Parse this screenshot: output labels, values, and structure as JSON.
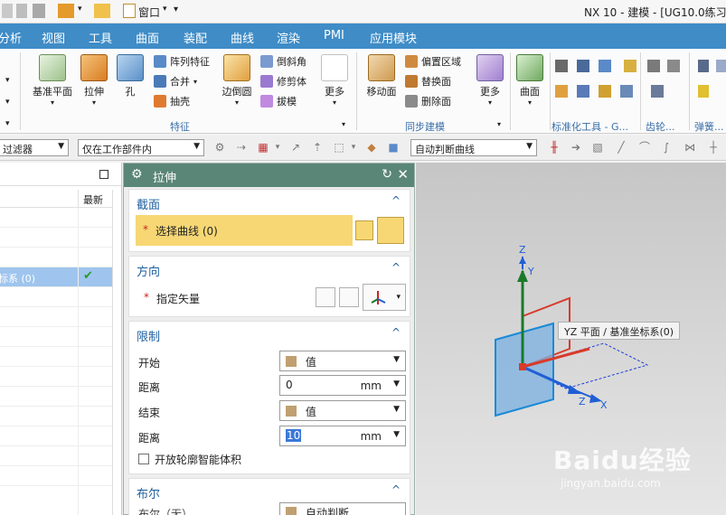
{
  "title_bar": {
    "window_menu": "窗口",
    "app_title": "NX 10 - 建模 - [UG10.0练习]"
  },
  "menu_bar": {
    "items": [
      "分析",
      "视图",
      "工具",
      "曲面",
      "装配",
      "曲线",
      "渲染",
      "PMI",
      "应用模块"
    ]
  },
  "ribbon": {
    "feature_group": {
      "label": "特征",
      "datum_plane": "基准平面",
      "extrude": "拉伸",
      "hole": "孔",
      "pattern_feature": "阵列特征",
      "unite": "合并",
      "shell": "抽壳",
      "edge_blend": "边倒圆",
      "chamfer": "倒斜角",
      "trim_body": "修剪体",
      "draft": "拔模",
      "more": "更多"
    },
    "sync_group": {
      "label": "同步建模",
      "move_face": "移动面",
      "offset_region": "偏置区域",
      "replace_face": "替换面",
      "delete_face": "删除面",
      "more": "更多"
    },
    "surface_label": "曲面",
    "standard_parts_label": "标准化工具 - G...",
    "gear_label": "齿轮...",
    "spring_label": "弹簧..."
  },
  "selection_bar": {
    "type_filter": "过滤器",
    "scope": "仅在工作部件内",
    "curve_rule": "自动判断曲线"
  },
  "navigator": {
    "col_latest": "最新",
    "selected_row": "标系 (0)",
    "check_mark": "✔"
  },
  "extrude_dialog": {
    "title": "拉伸",
    "section": {
      "header": "截面",
      "select_curve": "选择曲线 (0)",
      "required_mark": "*"
    },
    "direction": {
      "header": "方向",
      "specify_vector": "指定矢量",
      "required_mark": "*"
    },
    "limits": {
      "header": "限制",
      "start_label": "开始",
      "start_value": "值",
      "distance1_label": "距离",
      "distance1_value": "0",
      "distance1_unit": "mm",
      "end_label": "结束",
      "end_value": "值",
      "distance2_label": "距离",
      "distance2_value": "10",
      "distance2_unit": "mm",
      "open_profile": "开放轮廓智能体积"
    },
    "boolean": {
      "header": "布尔",
      "row_label": "布尔（无）",
      "row_value": "自动判断"
    }
  },
  "viewport": {
    "tooltip": "YZ 平面 / 基准坐标系(0)",
    "axis_z_top": "Z",
    "axis_y": "Y",
    "axis_z_bottom": "Z",
    "axis_x": "X",
    "watermark_brand": "Baidu经验",
    "watermark_url": "jingyan.baidu.com"
  },
  "colors": {
    "menu_bar": "#3f8cc7",
    "dialog_title": "#5a8678",
    "section_header": "#1e5f9e",
    "highlight_row": "#f7d774",
    "nav_selected": "#9fc5ee",
    "axis_green": "#1a7a2a",
    "axis_blue": "#1f5fd6",
    "axis_red": "#d93a2a"
  }
}
